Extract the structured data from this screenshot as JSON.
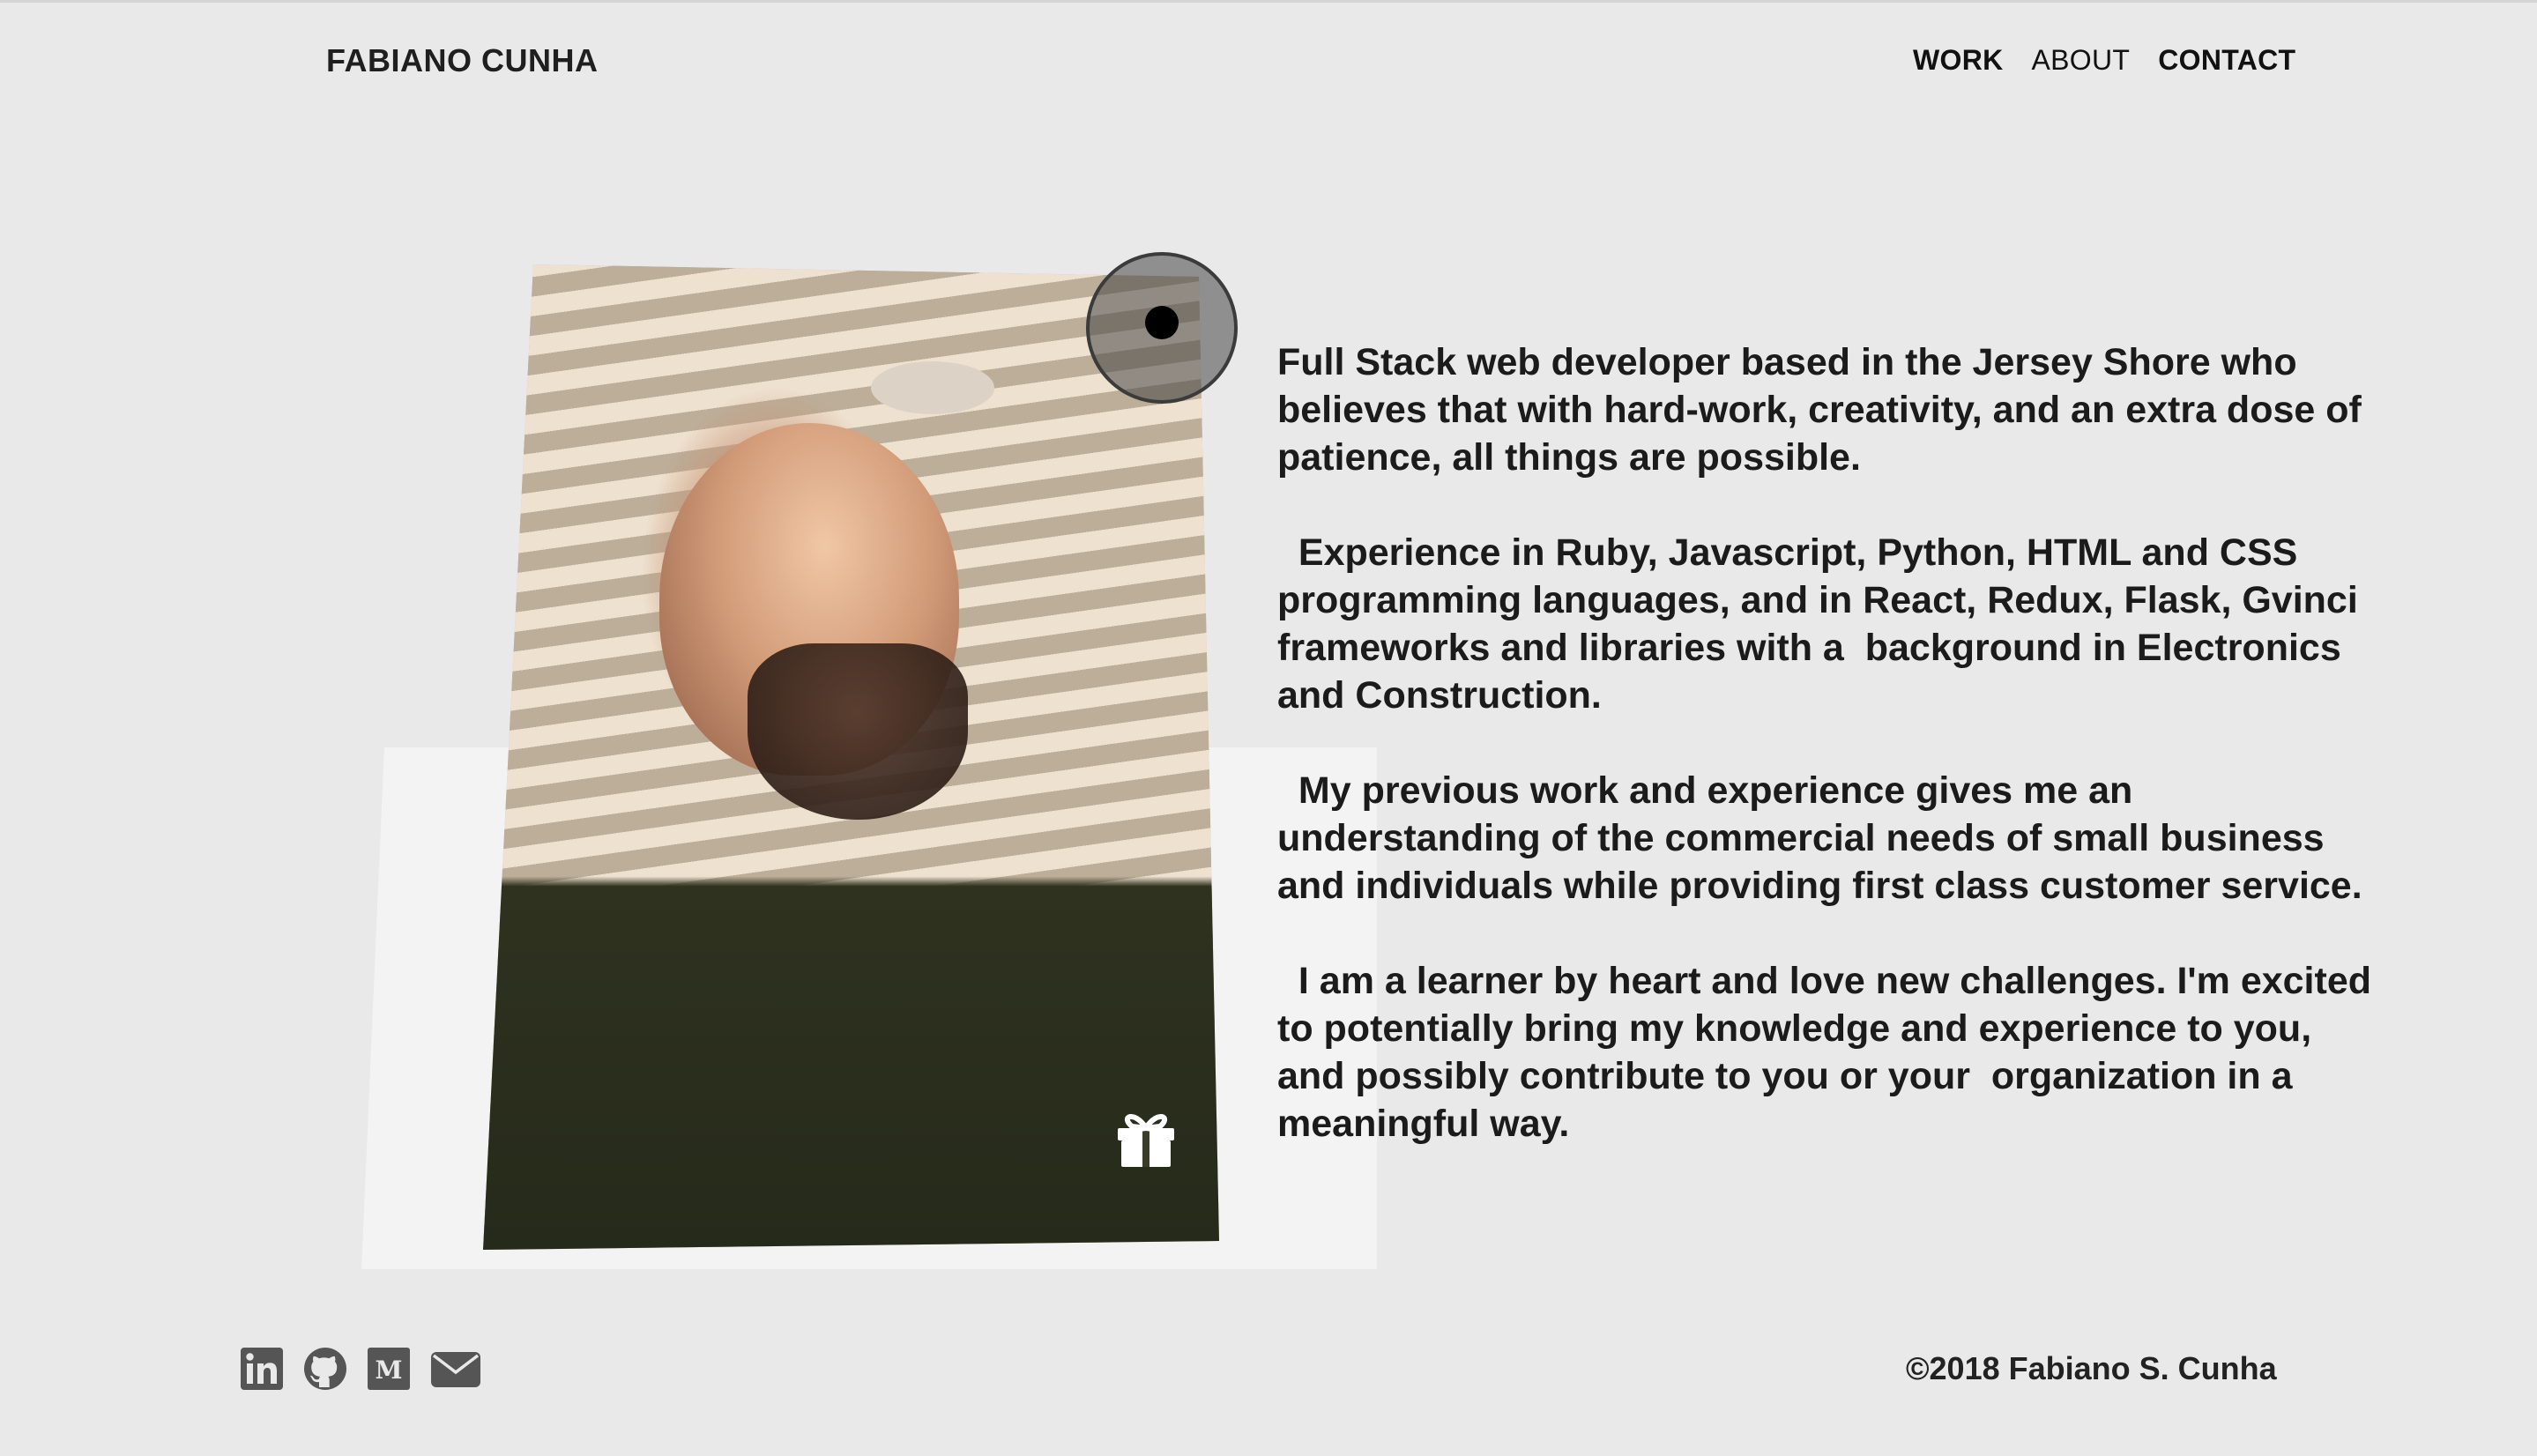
{
  "header": {
    "brand": "FABIANO CUNHA",
    "nav": [
      {
        "label": "WORK",
        "active": true
      },
      {
        "label": "ABOUT",
        "active": false
      },
      {
        "label": "CONTACT",
        "active": true
      }
    ]
  },
  "about": {
    "photo_alt": "Portrait of Fabiano Cunha looking up",
    "paragraphs": [
      "Full Stack web developer based in the Jersey Shore who believes that with hard-work, creativity, and an extra dose of patience, all things are possible.",
      "  Experience in Ruby, Javascript, Python, HTML and CSS programming languages, and in React, Redux, Flask, Gvinci frameworks and libraries with a  background in Electronics and Construction.",
      "  My previous work and experience gives me an understanding of the commercial needs of small business and individuals while providing first class customer service.",
      "  I am a learner by heart and love new challenges. I'm excited to potentially bring my knowledge and experience to you, and possibly contribute to you or your  organization in a meaningful way."
    ]
  },
  "footer": {
    "social": [
      {
        "name": "linkedin-icon"
      },
      {
        "name": "github-icon"
      },
      {
        "name": "medium-icon"
      },
      {
        "name": "email-icon"
      }
    ],
    "copyright": "©2018 Fabiano S. Cunha"
  },
  "colors": {
    "background": "#e9e9e9",
    "card": "#f3f3f3",
    "text": "#1b1b1b",
    "icon": "#555555"
  }
}
